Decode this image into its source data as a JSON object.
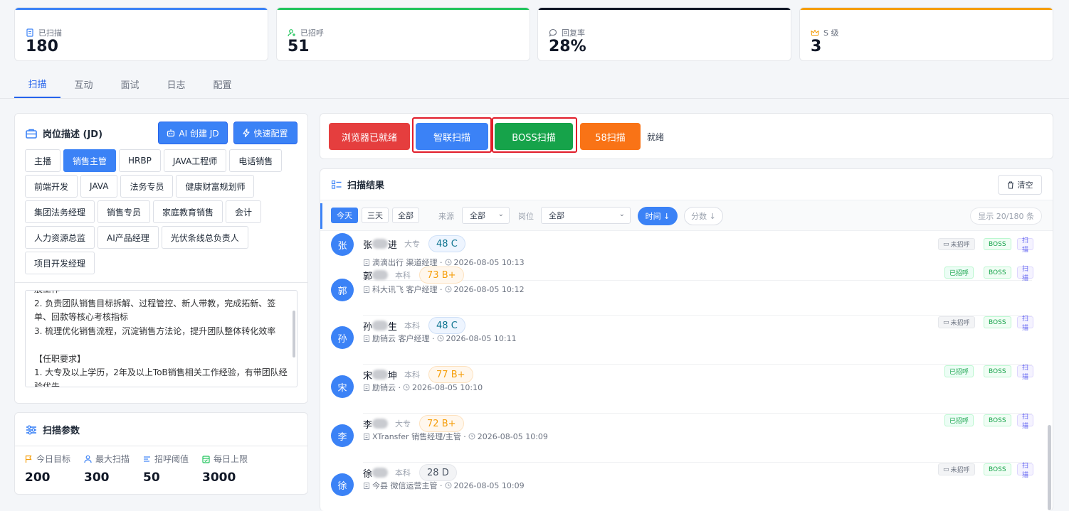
{
  "stats": [
    {
      "label": "已扫描",
      "value": "180",
      "color": "#3b82f6",
      "icon": "document-icon"
    },
    {
      "label": "已招呼",
      "value": "51",
      "color": "#22c55e",
      "icon": "user-plus-icon"
    },
    {
      "label": "回复率",
      "value": "28%",
      "color": "#111827",
      "icon": "chat-icon"
    },
    {
      "label": "S 级",
      "value": "3",
      "color": "#f59e0b",
      "icon": "crown-icon"
    }
  ],
  "tabs": [
    "扫描",
    "互动",
    "面试",
    "日志",
    "配置"
  ],
  "jd": {
    "title": "岗位描述 (JD)",
    "ai_create": "AI 创建 JD",
    "quick_config": "快速配置",
    "positions": [
      "主播",
      "销售主管",
      "HRBP",
      "JAVA工程师",
      "电话销售",
      "前端开发",
      "JAVA",
      "法务专员",
      "健康财富规划师",
      "集团法务经理",
      "销售专员",
      "家庭教育销售",
      "会计",
      "人力资源总监",
      "AI产品经理",
      "光伏条线总负责人",
      "项目开发经理"
    ],
    "selected": "销售主管",
    "text_lines": [
      "展工作",
      "2. 负责团队销售目标拆解、过程管控、新人带教，完成拓新、签",
      "单、回款等核心考核指标",
      "3. 梳理优化销售流程，沉淀销售方法论，提升团队整体转化效率",
      "",
      "【任职要求】",
      "1. 大专及以上学历，2年及以上ToB销售相关工作经验，有带团队经",
      "验优先"
    ]
  },
  "params": {
    "title": "扫描参数",
    "items": [
      {
        "label": "今日目标",
        "value": "200",
        "icon": "flag-icon"
      },
      {
        "label": "最大扫描",
        "value": "300",
        "icon": "user-icon"
      },
      {
        "label": "招呼阈值",
        "value": "50",
        "icon": "threshold-icon"
      },
      {
        "label": "每日上限",
        "value": "3000",
        "icon": "calendar-icon"
      }
    ]
  },
  "scan_buttons": {
    "browser": "浏览器已就绪",
    "zhilian": "智联扫描",
    "boss": "BOSS扫描",
    "s58": "58扫描",
    "status": "就绪"
  },
  "results": {
    "title": "扫描结果",
    "clear": "清空",
    "filters": {
      "today": "今天",
      "three_days": "三天",
      "all": "全部",
      "source_label": "来源",
      "source_value": "全部",
      "position_label": "岗位",
      "position_value": "全部",
      "time_sort": "时间 ↓",
      "score_sort": "分数 ↓",
      "count": "显示 20/180 条"
    },
    "candidates": [
      {
        "avatar": "张",
        "first": "张",
        "last": "进",
        "edu": "大专",
        "score": "48 C",
        "grade": "c",
        "meta": "滴滴出行 渠道经理 · ",
        "time": "2026-08-05 10:13",
        "greet": "未招呼",
        "greeted": false,
        "platform": "BOSS",
        "source": "扫描"
      },
      {
        "avatar": "郭",
        "first": "郭",
        "last": "",
        "edu": "本科",
        "score": "73 B+",
        "grade": "b",
        "meta": "科大讯飞 客户经理 · ",
        "time": "2026-08-05 10:12",
        "greet": "已招呼",
        "greeted": true,
        "platform": "BOSS",
        "source": "扫描"
      },
      {
        "avatar": "孙",
        "first": "孙",
        "last": "生",
        "edu": "本科",
        "score": "48 C",
        "grade": "c",
        "meta": "励销云 客户经理 · ",
        "time": "2026-08-05 10:11",
        "greet": "未招呼",
        "greeted": false,
        "platform": "BOSS",
        "source": "扫描"
      },
      {
        "avatar": "宋",
        "first": "宋",
        "last": "坤",
        "edu": "本科",
        "score": "77 B+",
        "grade": "b",
        "meta": "励销云 · ",
        "time": "2026-08-05 10:10",
        "greet": "已招呼",
        "greeted": true,
        "platform": "BOSS",
        "source": "扫描"
      },
      {
        "avatar": "李",
        "first": "李",
        "last": "",
        "edu": "大专",
        "score": "72 B+",
        "grade": "b",
        "meta": "XTransfer 销售经理/主管 · ",
        "time": "2026-08-05 10:09",
        "greet": "已招呼",
        "greeted": true,
        "platform": "BOSS",
        "source": "扫描"
      },
      {
        "avatar": "徐",
        "first": "徐",
        "last": "",
        "edu": "本科",
        "score": "28 D",
        "grade": "d",
        "meta": "今县 微信运营主管 · ",
        "time": "2026-08-05 10:09",
        "greet": "未招呼",
        "greeted": false,
        "platform": "BOSS",
        "source": "扫描"
      }
    ]
  }
}
